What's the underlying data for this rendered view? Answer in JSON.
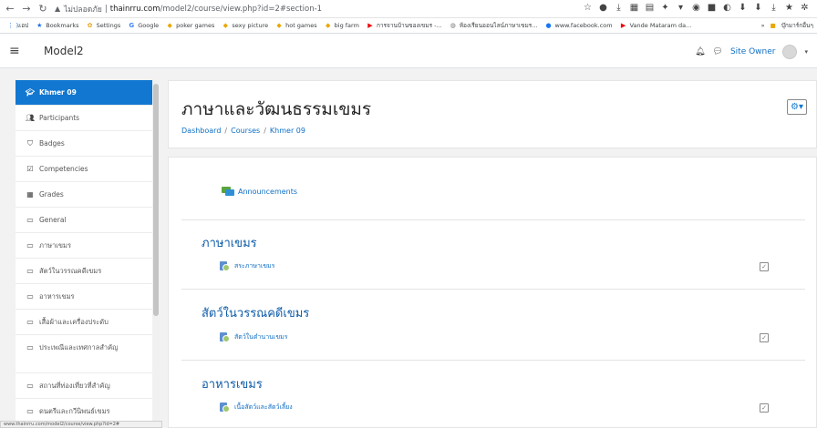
{
  "browser": {
    "url_warning": "ไม่ปลอดภัย",
    "url_host": "thainrru.com",
    "url_path": "/model2/course/view.php?id=2#section-1"
  },
  "bookmarks": {
    "items": [
      {
        "label": "แอป",
        "icon": "apps-grid-icon"
      },
      {
        "label": "Bookmarks",
        "icon": "star-icon"
      },
      {
        "label": "Settings",
        "icon": "gear-icon"
      },
      {
        "label": "Google",
        "icon": "google-icon"
      },
      {
        "label": "poker games",
        "icon": "folder-icon"
      },
      {
        "label": "sexy picture",
        "icon": "folder-icon"
      },
      {
        "label": "hot games",
        "icon": "folder-icon"
      },
      {
        "label": "big farm",
        "icon": "folder-icon"
      },
      {
        "label": "การจานบ้านของเขมร -...",
        "icon": "youtube-icon"
      },
      {
        "label": "ห้องเรียนออนไลน์ภาษาเขมร...",
        "icon": "globe-icon"
      },
      {
        "label": "www.facebook.com",
        "icon": "facebook-icon"
      },
      {
        "label": "Vande Mataram da...",
        "icon": "youtube-icon"
      }
    ],
    "overflow": "»",
    "other": "บุ๊กมาร์กอื่นๆ"
  },
  "navbar": {
    "brand": "Model2",
    "user_label": "Site Owner"
  },
  "sidebar": {
    "items": [
      {
        "label": "Khmer 09",
        "icon": "graduation-cap-icon",
        "active": true
      },
      {
        "label": "Participants",
        "icon": "users-icon"
      },
      {
        "label": "Badges",
        "icon": "shield-icon"
      },
      {
        "label": "Competencies",
        "icon": "check-square-icon"
      },
      {
        "label": "Grades",
        "icon": "table-icon"
      },
      {
        "label": "General",
        "icon": "folder-icon"
      },
      {
        "label": "ภาษาเขมร",
        "icon": "folder-icon"
      },
      {
        "label": "สัตว์ในวรรณคดีเขมร",
        "icon": "folder-icon"
      },
      {
        "label": "อาหารเขมร",
        "icon": "folder-icon"
      },
      {
        "label": "เสื้อผ้าและเครื่องประดับ",
        "icon": "folder-icon"
      },
      {
        "label": "ประเพณีและเทศกาลสำคัญ",
        "icon": "folder-icon"
      },
      {
        "label": "สถานที่ท่องเที่ยวที่สำคัญ",
        "icon": "folder-icon"
      },
      {
        "label": "ดนตรีและกวีนิพนธ์เขมร",
        "icon": "folder-icon"
      }
    ]
  },
  "header": {
    "title": "ภาษาและวัฒนธรรมเขมร",
    "breadcrumb": [
      "Dashboard",
      "Courses",
      "Khmer 09"
    ]
  },
  "main": {
    "announcements": "Announcements",
    "sections": [
      {
        "title": "ภาษาเขมร",
        "activity": "สระภาษาเขมร"
      },
      {
        "title": "สัตว์ในวรรณคดีเขมร",
        "activity": "สัตว์ในตำนานเขมร"
      },
      {
        "title": "อาหารเขมร",
        "activity": "เนื้อสัตว์และสัตว์เลี้ยง"
      }
    ]
  },
  "status_bar": {
    "url": "www.thainrru.com/model2/course/view.php?id=2#"
  }
}
